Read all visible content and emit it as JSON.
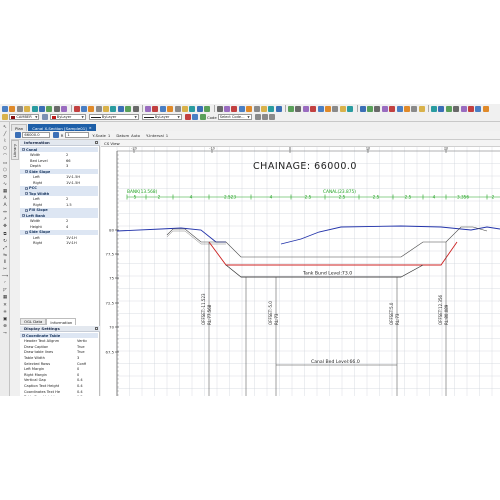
{
  "toolbar": {
    "layer_combo": "CAMBER",
    "color_combo": "ByLayer",
    "linetype_combo": "ByLayer",
    "lineweight_combo": "ByLayer",
    "code_label": "Code",
    "code_combo": "Select Code...",
    "colors": {
      "layer": "#8b1010",
      "color": "#c01818"
    }
  },
  "vertical_tools": [
    "pointer-icon",
    "line-icon",
    "polyline-icon",
    "circle-icon",
    "arc-icon",
    "rectangle-icon",
    "polygon-icon",
    "ellipse-icon",
    "spline-icon",
    "hatch-icon",
    "text-icon",
    "mtext-icon",
    "dimension-icon",
    "leader-icon",
    "move-icon",
    "copy-icon",
    "rotate-icon",
    "scale-icon",
    "mirror-icon",
    "offset-icon",
    "trim-icon",
    "extend-icon",
    "fillet-icon",
    "chamfer-icon",
    "array-icon",
    "erase-icon",
    "explode-icon",
    "block-icon",
    "insert-icon",
    "measure-icon"
  ],
  "tabs": [
    {
      "label": "Plan",
      "active": false
    },
    {
      "label": "Canal X-Section [Sample01]",
      "active": true,
      "close": "×"
    }
  ],
  "options_bar": {
    "chainage_value": "66000.0",
    "r_label": "R",
    "r_value": "1",
    "yscale_label": "Y-Scale",
    "yscale_value": "1",
    "datum_label": "Datum",
    "datum_value": "Auto",
    "yinterval_label": "Y-Interval",
    "yinterval_value": "1"
  },
  "left_tab_label": "Library",
  "information_panel": {
    "title": "Information",
    "rows": [
      {
        "type": "section",
        "label": "Canal"
      },
      {
        "label": "Width",
        "value": "2",
        "indent": 2
      },
      {
        "label": "Bed Level",
        "value": "66",
        "indent": 2
      },
      {
        "label": "Depth",
        "value": "3",
        "indent": 2
      },
      {
        "type": "section",
        "label": "Side Slope",
        "indent": 1
      },
      {
        "label": "Left",
        "value": "1V:1.5H",
        "indent": 3
      },
      {
        "label": "Right",
        "value": "1V:1.5H",
        "indent": 3
      },
      {
        "type": "section",
        "label": "PCC",
        "indent": 1
      },
      {
        "type": "section",
        "label": "Top Width",
        "indent": 1
      },
      {
        "label": "Left",
        "value": "2",
        "indent": 3
      },
      {
        "label": "Right",
        "value": "1.5",
        "indent": 3
      },
      {
        "type": "section",
        "label": "Fill Slope",
        "indent": 1
      },
      {
        "type": "section",
        "label": "Left Bank"
      },
      {
        "label": "Width",
        "value": "2",
        "indent": 2
      },
      {
        "label": "Height",
        "value": "4",
        "indent": 2
      },
      {
        "type": "section",
        "label": "Side Slope",
        "indent": 1
      },
      {
        "label": "Left",
        "value": "1V:1H",
        "indent": 3
      },
      {
        "label": "Right",
        "value": "1V:1H",
        "indent": 3
      }
    ]
  },
  "panel_tabs": [
    {
      "label": "OGL Data",
      "active": false
    },
    {
      "label": "Information",
      "active": true
    }
  ],
  "display_panel": {
    "title": "Display Settings",
    "rows": [
      {
        "type": "section",
        "label": "Coordinate Table"
      },
      {
        "label": "Header Text Alignm",
        "value": "Vertic"
      },
      {
        "label": "Draw Caption",
        "value": "True"
      },
      {
        "label": "Draw table lines",
        "value": "True"
      },
      {
        "label": "Table Width",
        "value": "3"
      },
      {
        "label": "Selected Rows",
        "value": "Confi"
      },
      {
        "label": "Left Margin",
        "value": "0"
      },
      {
        "label": "Right Margin",
        "value": "0"
      },
      {
        "label": "Vertical Gap",
        "value": "0.4"
      },
      {
        "label": "Caption Text Height",
        "value": "0.4"
      },
      {
        "label": "Coordinates Text He",
        "value": "0.4"
      },
      {
        "label": "Table Row Height",
        "value": "1.5"
      },
      {
        "label": "Minimum Spacing",
        "value": "0.4"
      },
      {
        "label": "Precision",
        "value": "0"
      },
      {
        "label": "Auto Adjust Table T",
        "value": "False"
      },
      {
        "label": "ve sign for Offset",
        "value": "True"
      },
      {
        "type": "section",
        "label": "Grid"
      }
    ]
  },
  "view": {
    "header": "CS View",
    "chainage": "CHAINAGE:  66000.0",
    "bank_label": "BANK(13.568)",
    "canal_label": "CANAL(23.875)",
    "dim_values": [
      "5",
      "2",
      "4",
      "2.523",
      "4",
      "2.5",
      "2.5",
      "2.5",
      "2.5",
      "4",
      "3.356",
      "2"
    ],
    "tick_labels": [
      "-20",
      "-10",
      "0",
      "10",
      "20"
    ],
    "y_labels": [
      "80",
      "77.5",
      "75",
      "72.5",
      "70",
      "67.5"
    ],
    "tank_label": "Tank  Bund  Level:73.0",
    "canal_bed_label": "Canal  Bed  Level:66.0",
    "offsets": [
      {
        "offset": "OFFSET:-11.523",
        "rl": "RL:77.568"
      },
      {
        "offset": "OFFSET:-5.0",
        "rl": "RL:73"
      },
      {
        "offset": "OFFSET:5.0",
        "rl": "RL:73"
      },
      {
        "offset": "OFFSET:12.356",
        "rl": "RL:80.089"
      }
    ],
    "colors": {
      "ground": "#2233aa",
      "section": "#cc2222",
      "dim": "#21a321",
      "grid": "#cfd4dc",
      "text": "#222222"
    }
  }
}
